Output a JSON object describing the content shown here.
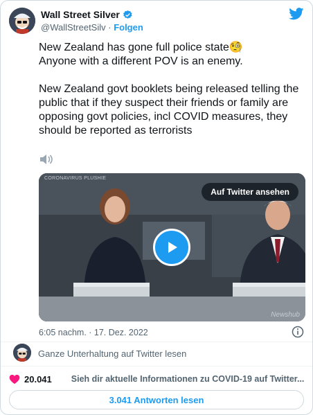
{
  "author": {
    "display_name": "Wall Street Silver",
    "handle": "@WallStreetSilv",
    "separator": " · ",
    "follow_label": "Folgen"
  },
  "tweet": {
    "text": "New Zealand has gone full police state🧐\nAnyone with a different POV is an enemy.\n\nNew Zealand govt booklets being released telling the public that if they suspect their friends or family are opposing govt policies, incl COVID measures, they should be reported as terrorists",
    "timestamp": "6:05 nachm. · 17. Dez. 2022"
  },
  "video": {
    "watch_label": "Auf Twitter ansehen",
    "top_label": "CORONAVIRUS PLUSHIE",
    "corner_mark": "Newshub"
  },
  "conversation": {
    "label": "Ganze Unterhaltung auf Twitter lesen"
  },
  "actions": {
    "like_count": "20.041",
    "covid_info": "Sieh dir aktuelle Informationen zu COVID-19 auf Twitter..."
  },
  "replies": {
    "label": "3.041 Antworten lesen"
  },
  "colors": {
    "accent": "#1d9bf0",
    "like": "#f91880",
    "muted": "#536471"
  },
  "icons": [
    "verified-badge-icon",
    "twitter-logo-icon",
    "speaker-icon",
    "play-icon",
    "info-icon",
    "heart-icon",
    "lightning-icon"
  ]
}
